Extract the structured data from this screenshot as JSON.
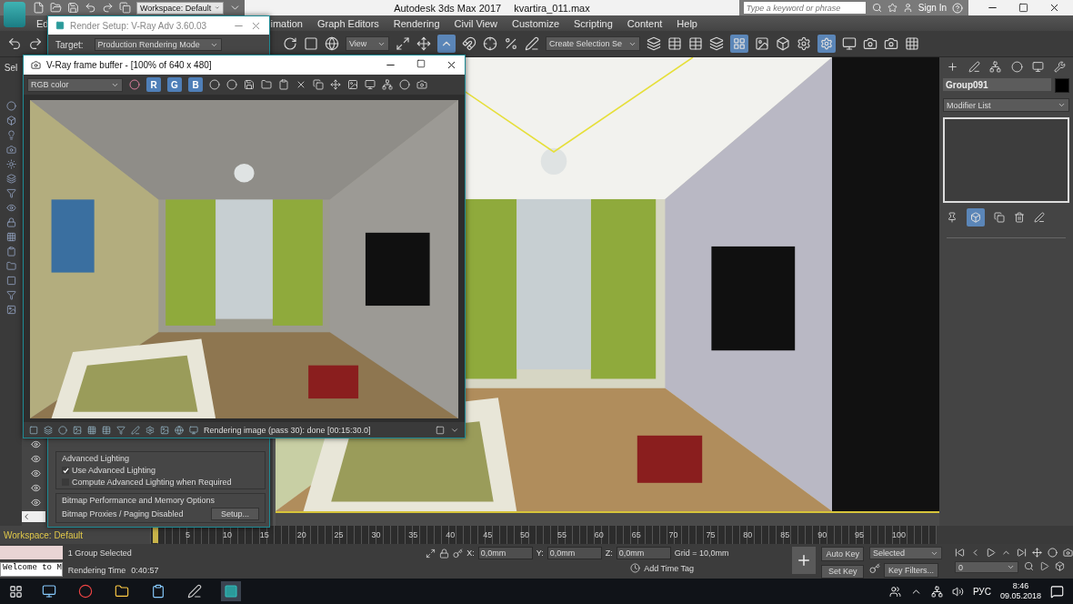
{
  "app": {
    "workspace": "Workspace: Default",
    "title": "Autodesk 3ds Max 2017",
    "file": "kvartira_011.max",
    "search_placeholder": "Type a keyword or phrase",
    "sign_in": "Sign In"
  },
  "menu": [
    "Ed",
    "imation",
    "Graph Editors",
    "Rendering",
    "Civil View",
    "Customize",
    "Scripting",
    "Content",
    "Help"
  ],
  "toolbar": {
    "view": "View",
    "selection_set": "Create Selection Se"
  },
  "scene_explorer": {
    "menu": "Sel"
  },
  "render_setup": {
    "title": "Render Setup: V-Ray Adv 3.60.03",
    "target_label": "Target:",
    "target_value": "Production Rendering Mode",
    "lighting_title": "Advanced Lighting",
    "options": [
      {
        "label": "Use Advanced Lighting",
        "checked": true
      },
      {
        "label": "Compute Advanced Lighting when Required",
        "checked": false
      }
    ],
    "bitmap_title": "Bitmap Performance and Memory Options",
    "bitmap_text": "Bitmap Proxies / Paging Disabled",
    "bitmap_button": "Setup..."
  },
  "frame_buffer": {
    "title": "V-Ray frame buffer - [100% of 640 x 480]",
    "channel": "RGB color",
    "channels": [
      {
        "label": "R",
        "selected": true
      },
      {
        "label": "G",
        "selected": true
      },
      {
        "label": "B",
        "selected": true
      }
    ],
    "status": "Rendering image (pass 30): done [00:15:30.0]"
  },
  "command_panel": {
    "object_name": "Group091",
    "modifier_list": "Modifier List"
  },
  "timeline": {
    "workspace": "Workspace: Default",
    "level": 0,
    "ticks": [
      "5",
      "10",
      "15",
      "20",
      "25",
      "30",
      "35",
      "40",
      "45",
      "50",
      "55",
      "60",
      "65",
      "70",
      "75",
      "80",
      "85",
      "90",
      "95",
      "100"
    ]
  },
  "status": {
    "listener": "Welcome to M",
    "selection": "1 Group Selected",
    "render_time_label": "Rendering Time",
    "render_time": "0:40:57",
    "x_label": "X:",
    "x": "0,0mm",
    "y_label": "Y:",
    "y": "0,0mm",
    "z_label": "Z:",
    "z": "0,0mm",
    "grid": "Grid = 10,0mm",
    "add_time_tag": "Add Time Tag",
    "auto_key": "Auto Key",
    "key_mode": "Selected",
    "set_key": "Set Key",
    "key_filters": "Key Filters...",
    "frame": "0"
  },
  "taskbar": {
    "language": "РУС",
    "time": "8:46",
    "date": "09.05.2018"
  }
}
